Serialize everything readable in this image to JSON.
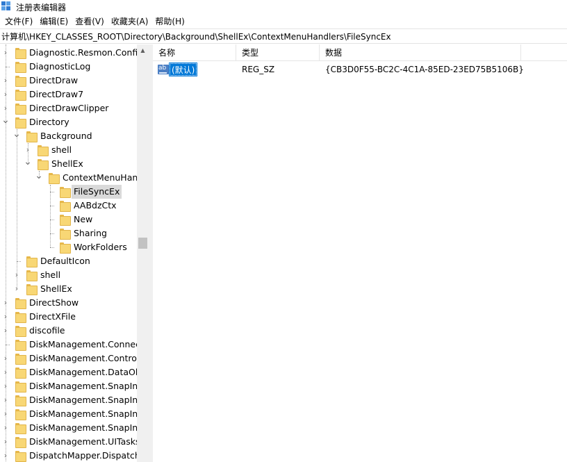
{
  "window": {
    "title": "注册表编辑器"
  },
  "menu": [
    {
      "label": "文件(F)"
    },
    {
      "label": "编辑(E)"
    },
    {
      "label": "查看(V)"
    },
    {
      "label": "收藏夹(A)"
    },
    {
      "label": "帮助(H)"
    }
  ],
  "address": {
    "path": "计算机\\HKEY_CLASSES_ROOT\\Directory\\Background\\ShellEx\\ContextMenuHandlers\\FileSyncEx"
  },
  "tree": {
    "items": [
      {
        "label": "Diagnostic.Resmon.Config",
        "depth": 0,
        "arrow": ">",
        "selected": false
      },
      {
        "label": "DiagnosticLog",
        "depth": 0,
        "arrow": "",
        "selected": false
      },
      {
        "label": "DirectDraw",
        "depth": 0,
        "arrow": ">",
        "selected": false
      },
      {
        "label": "DirectDraw7",
        "depth": 0,
        "arrow": ">",
        "selected": false
      },
      {
        "label": "DirectDrawClipper",
        "depth": 0,
        "arrow": ">",
        "selected": false
      },
      {
        "label": "Directory",
        "depth": 0,
        "arrow": "v",
        "selected": false
      },
      {
        "label": "Background",
        "depth": 1,
        "arrow": "v",
        "selected": false
      },
      {
        "label": "shell",
        "depth": 2,
        "arrow": ">",
        "selected": false
      },
      {
        "label": "ShellEx",
        "depth": 2,
        "arrow": "v",
        "selected": false
      },
      {
        "label": "ContextMenuHandlers",
        "depth": 3,
        "arrow": "v",
        "selected": false
      },
      {
        "label": "FileSyncEx",
        "depth": 4,
        "arrow": "",
        "selected": true
      },
      {
        "label": "AABdzCtx",
        "depth": 4,
        "arrow": "",
        "selected": false
      },
      {
        "label": "New",
        "depth": 4,
        "arrow": "",
        "selected": false
      },
      {
        "label": "Sharing",
        "depth": 4,
        "arrow": "",
        "selected": false
      },
      {
        "label": "WorkFolders",
        "depth": 4,
        "arrow": "",
        "selected": false
      },
      {
        "label": "DefaultIcon",
        "depth": 1,
        "arrow": "",
        "selected": false
      },
      {
        "label": "shell",
        "depth": 1,
        "arrow": ">",
        "selected": false
      },
      {
        "label": "ShellEx",
        "depth": 1,
        "arrow": ">",
        "selected": false
      },
      {
        "label": "DirectShow",
        "depth": 0,
        "arrow": ">",
        "selected": false
      },
      {
        "label": "DirectXFile",
        "depth": 0,
        "arrow": ">",
        "selected": false
      },
      {
        "label": "discofile",
        "depth": 0,
        "arrow": ">",
        "selected": false
      },
      {
        "label": "DiskManagement.Connection",
        "depth": 0,
        "arrow": "",
        "selected": false
      },
      {
        "label": "DiskManagement.Control",
        "depth": 0,
        "arrow": ">",
        "selected": false
      },
      {
        "label": "DiskManagement.DataObject",
        "depth": 0,
        "arrow": ">",
        "selected": false
      },
      {
        "label": "DiskManagement.SnapIn",
        "depth": 0,
        "arrow": ">",
        "selected": false
      },
      {
        "label": "DiskManagement.SnapInAbout",
        "depth": 0,
        "arrow": ">",
        "selected": false
      },
      {
        "label": "DiskManagement.SnapInComponent",
        "depth": 0,
        "arrow": ">",
        "selected": false
      },
      {
        "label": "DiskManagement.SnapInExtension",
        "depth": 0,
        "arrow": ">",
        "selected": false
      },
      {
        "label": "DiskManagement.UITasks",
        "depth": 0,
        "arrow": ">",
        "selected": false
      },
      {
        "label": "DispatchMapper.DispatchMapper",
        "depth": 0,
        "arrow": ">",
        "selected": false
      }
    ]
  },
  "list": {
    "columns": [
      {
        "label": "名称"
      },
      {
        "label": "类型"
      },
      {
        "label": "数据"
      }
    ],
    "rows": [
      {
        "icon": "string-value-icon",
        "icon_text": "ab",
        "name": "(默认)",
        "type": "REG_SZ",
        "data": "{CB3D0F55-BC2C-4C1A-85ED-23ED75B5106B}"
      }
    ]
  },
  "colors": {
    "selection": "#0078d7",
    "tree_selection": "#d9d9d9",
    "folder": "#f8d775"
  }
}
